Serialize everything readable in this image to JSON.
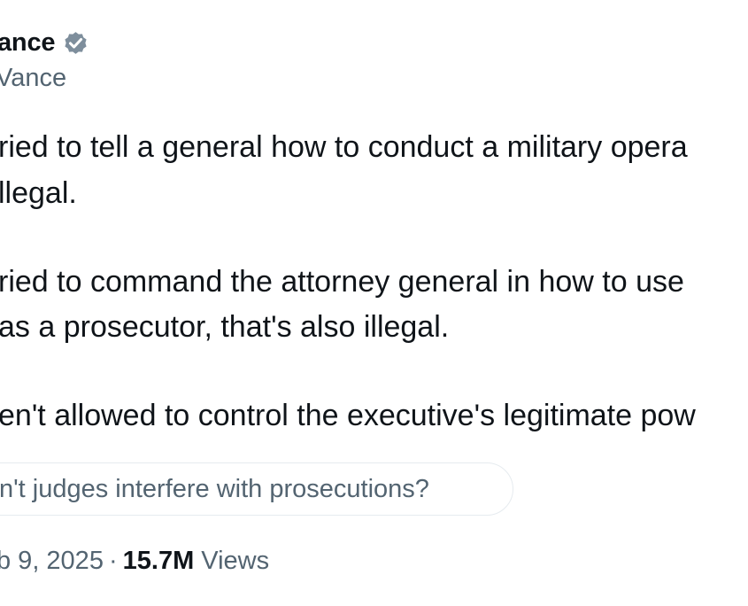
{
  "author": {
    "display_name": "ance",
    "handle": "Vance",
    "verified_icon": "verified-badge-icon",
    "verified_color": "#7e8e9c"
  },
  "tweet": {
    "lines": [
      "ried to tell a general how to conduct a military opera",
      "llegal.",
      "ried to command the attorney general in how to use",
      "as a prosecutor, that's also illegal.",
      "en't allowed to control the executive's legitimate pow"
    ]
  },
  "related_question": {
    "label": "n't judges interfere with prosecutions?"
  },
  "meta": {
    "date": "b 9, 2025",
    "separator": "·",
    "views_count": "15.7M",
    "views_label": "Views"
  },
  "colors": {
    "text_primary": "#0f1419",
    "text_secondary": "#536471",
    "pill_border": "#e6ebef"
  }
}
